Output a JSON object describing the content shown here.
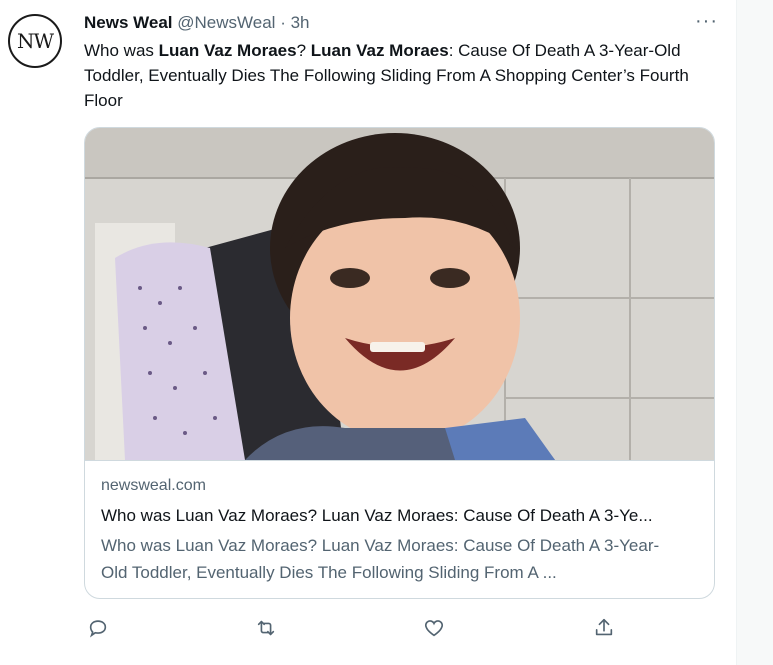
{
  "author": {
    "name": "News Weal",
    "handle": "@NewsWeal",
    "separator": "·",
    "time": "3h",
    "avatar_text": "NW"
  },
  "tweet_text": {
    "part1": "Who was ",
    "bold1": "Luan Vaz Moraes",
    "part2": "? ",
    "bold2": "Luan Vaz Moraes",
    "part3": ": Cause Of Death A 3-Year-Old Toddler, Eventually Dies The Following Sliding From A Shopping Center’s Fourth Floor"
  },
  "more_label": "···",
  "card": {
    "domain": "newsweal.com",
    "title": "Who was Luan Vaz Moraes? Luan Vaz Moraes: Cause Of Death A 3-Ye...",
    "description": "Who was Luan Vaz Moraes? Luan Vaz Moraes: Cause Of Death A 3-Year-Old Toddler, Eventually Dies The Following Sliding From A ..."
  },
  "actions": [
    "reply-icon",
    "retweet-icon",
    "like-icon",
    "share-icon"
  ],
  "colors": {
    "text_primary": "#0f1419",
    "text_secondary": "#536471",
    "border": "#cfd9de"
  }
}
